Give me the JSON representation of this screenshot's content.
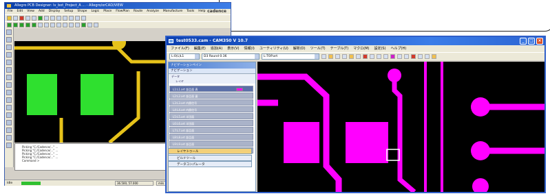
{
  "left_window": {
    "title": "Allegro PCB Designer: lv_bot_Project_A ... - Allegro/orCAD/VIEW",
    "menu": [
      "File",
      "Edit",
      "View",
      "Add",
      "Display",
      "Setup",
      "Shape",
      "Logic",
      "Place",
      "FlowPlan",
      "Route",
      "Analyze",
      "Manufacture",
      "Tools",
      "Help"
    ],
    "brand": "cadence",
    "command_lines": [
      "Picking \"C:/Cadence/...\" ...",
      "Picking \"C:/Cadence/...\" ...",
      "Picking \"C:/Cadence/...\" ...",
      "Picking \"C:/Cadence/...\" ...",
      "Command >"
    ],
    "status": {
      "label": "Idle",
      "coord": "36.500, 57.000",
      "unit": "mils"
    }
  },
  "right_window": {
    "title": "test0533.cam - CAM350 V 10.7",
    "menu": [
      "ファイル(F)",
      "編集(E)",
      "追加(A)",
      "表示(V)",
      "情報(I)",
      "ユーティリティ(U)",
      "解析(D)",
      "ツール(T)",
      "テーブル(T)",
      "マクロ(M)",
      "設定(S)",
      "ヘルプ(H)"
    ],
    "combo1": "L:0(L)L1",
    "combo2": "D3 Round 0.36",
    "combo3": "L:TOP.art",
    "panel_title": "ナビゲーションペイン",
    "panel_sub": "ナビゲーション",
    "data_label": "データ",
    "layer_label": "レイヤ",
    "layers": [
      {
        "name": "L1:L1.art",
        "desc": "部品面 表"
      },
      {
        "name": "L2:L2.art",
        "desc": "部品面 裏"
      },
      {
        "name": "L3:L3.art",
        "desc": "内層信号"
      },
      {
        "name": "L4:L4.art",
        "desc": "内層信号"
      },
      {
        "name": "L5:L5.art",
        "desc": "半田面"
      },
      {
        "name": "L6:L6.art",
        "desc": "半田面"
      },
      {
        "name": "L7:L7.art",
        "desc": "部品面"
      },
      {
        "name": "L8:L8.art",
        "desc": "部品面"
      },
      {
        "name": "L9:L9.art",
        "desc": "部品面"
      },
      {
        "name": "L10:L10.art",
        "desc": "部品面"
      },
      {
        "name": "L11:DRILL.art",
        "desc": "ドリル"
      }
    ],
    "buttons": [
      "レイヤトゥール",
      "ビルドツール",
      "データコンパレータ"
    ]
  },
  "colors": {
    "copper_right": "#ff00ff",
    "pad_left": "#2fe02f",
    "trace_left": "#e6c21a"
  }
}
